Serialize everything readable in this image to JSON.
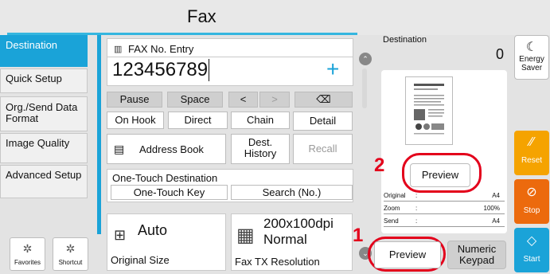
{
  "header": {
    "title": "Fax"
  },
  "sidebar": {
    "items": [
      {
        "label": "Destination"
      },
      {
        "label": "Quick Setup"
      },
      {
        "label": "Org./Send Data Format"
      },
      {
        "label": "Image Quality"
      },
      {
        "label": "Advanced Setup"
      }
    ],
    "favorites_label": "Favorites",
    "shortcut_label": "Shortcut"
  },
  "entry": {
    "title": "FAX No. Entry",
    "value": "123456789",
    "add_symbol": "+"
  },
  "keys": {
    "pause": "Pause",
    "space": "Space",
    "left": "<",
    "right": ">",
    "backspace": "⌫",
    "on_hook": "On Hook",
    "direct": "Direct",
    "chain": "Chain",
    "detail": "Detail",
    "address_book": "Address Book",
    "dest_history": "Dest. History",
    "recall": "Recall"
  },
  "one_touch": {
    "title": "One-Touch Destination",
    "key": "One-Touch Key",
    "search": "Search (No.)"
  },
  "original_size": {
    "value": "Auto",
    "label": "Original Size"
  },
  "fax_res": {
    "value": "200x100dpi Normal",
    "label": "Fax TX Resolution"
  },
  "destination": {
    "label": "Destination",
    "count": "0",
    "preview_button": "Preview",
    "info": [
      {
        "label": "Original",
        "value": "A4"
      },
      {
        "label": "Zoom",
        "value": "100%"
      },
      {
        "label": "Send",
        "value": "A4"
      }
    ]
  },
  "bottom": {
    "preview": "Preview",
    "numeric_keypad": "Numeric Keypad"
  },
  "right_panel": {
    "energy_saver": "Energy Saver",
    "reset": "Reset",
    "stop": "Stop",
    "start": "Start",
    "colors": {
      "reset": "#f5a300",
      "stop": "#ec6a0d",
      "start": "#1aa3d8"
    }
  },
  "callouts": {
    "one": "1",
    "two": "2"
  }
}
